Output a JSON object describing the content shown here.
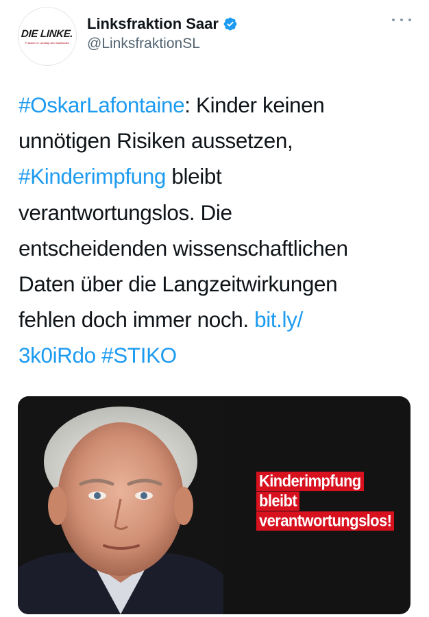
{
  "author": {
    "display_name": "Linksfraktion Saar",
    "handle": "@LinksfraktionSL",
    "verified": true,
    "avatar_brand": "DIE LINKE.",
    "avatar_subtitle": "Fraktion im Landtag des Saarlandes"
  },
  "menu": {
    "icon": "more-horizontal-icon"
  },
  "tweet": {
    "lines": [
      {
        "parts": [
          {
            "text": "#OskarLafontaine",
            "link": true
          },
          {
            "text": ": Kinder keinen",
            "link": false
          }
        ]
      },
      {
        "parts": [
          {
            "text": "unnötigen Risiken aussetzen,",
            "link": false
          }
        ]
      },
      {
        "parts": [
          {
            "text": "#Kinderimpfung",
            "link": true
          },
          {
            "text": " bleibt",
            "link": false
          }
        ]
      },
      {
        "parts": [
          {
            "text": "verantwortungslos. Die",
            "link": false
          }
        ]
      },
      {
        "parts": [
          {
            "text": "entscheidenden wissenschaftlichen",
            "link": false
          }
        ]
      },
      {
        "parts": [
          {
            "text": "Daten über die Langzeitwirkungen",
            "link": false
          }
        ]
      },
      {
        "parts": [
          {
            "text": "fehlen doch immer noch. ",
            "link": false
          },
          {
            "text": "bit.ly/",
            "link": true
          }
        ]
      },
      {
        "parts": [
          {
            "text": "3k0iRdo",
            "link": true
          },
          {
            "text": " ",
            "link": false
          },
          {
            "text": "#STIKO",
            "link": true
          }
        ]
      }
    ]
  },
  "media": {
    "caption_lines": [
      "Kinderimpfung",
      "bleibt",
      "verantwortungslos!"
    ]
  },
  "colors": {
    "link": "#1d9bf0",
    "verified": "#1d9bf0",
    "caption_bg": "#d8111f",
    "media_bg": "#131313"
  }
}
